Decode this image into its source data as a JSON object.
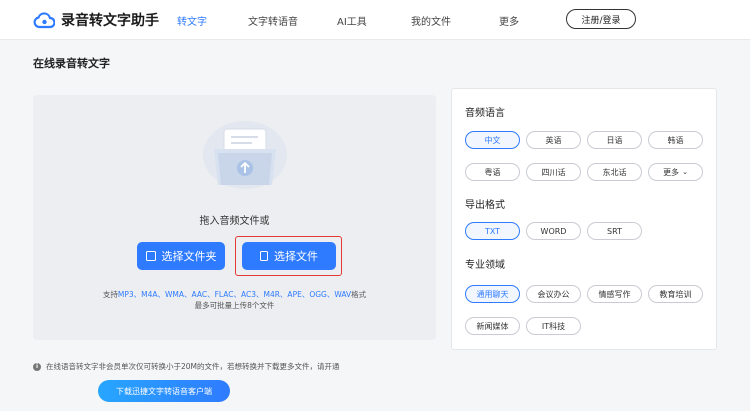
{
  "header": {
    "app_title": "录音转文字助手",
    "nav": [
      "转文字",
      "文字转语音",
      "AI工具",
      "我的文件",
      "更多"
    ],
    "login_label": "注册/登录"
  },
  "page_title": "在线录音转文字",
  "upload": {
    "drop_text": "拖入音频文件或",
    "select_folder_label": "选择文件夹",
    "select_file_label": "选择文件",
    "formats_prefix": "支持",
    "formats": "MP3、M4A、WMA、AAC、FLAC、AC3、M4R、APE、OGG、WAV",
    "formats_suffix": "格式",
    "limit_text": "最多可批量上传8个文件"
  },
  "settings": {
    "language_title": "音频语言",
    "languages": [
      "中文",
      "英语",
      "日语",
      "韩语",
      "粤语",
      "四川话",
      "东北话",
      "更多"
    ],
    "language_selected": "中文",
    "export_title": "导出格式",
    "export_formats": [
      "TXT",
      "WORD",
      "SRT"
    ],
    "export_selected": "TXT",
    "domain_title": "专业领域",
    "domains": [
      "通用聊天",
      "会议办公",
      "情感写作",
      "教育培训",
      "新闻媒体",
      "IT科技"
    ],
    "domain_selected": "通用聊天"
  },
  "notice": {
    "icon": "info-icon",
    "text": "在线语音转文字非会员单次仅可转换小于20M的文件，若想转换并下载更多文件，请开通"
  },
  "download_label": "下载迅捷文字转语音客户端",
  "colors": {
    "accent": "#2f7bff",
    "highlight_border": "#e53935",
    "panel_bg": "#eceef1"
  }
}
